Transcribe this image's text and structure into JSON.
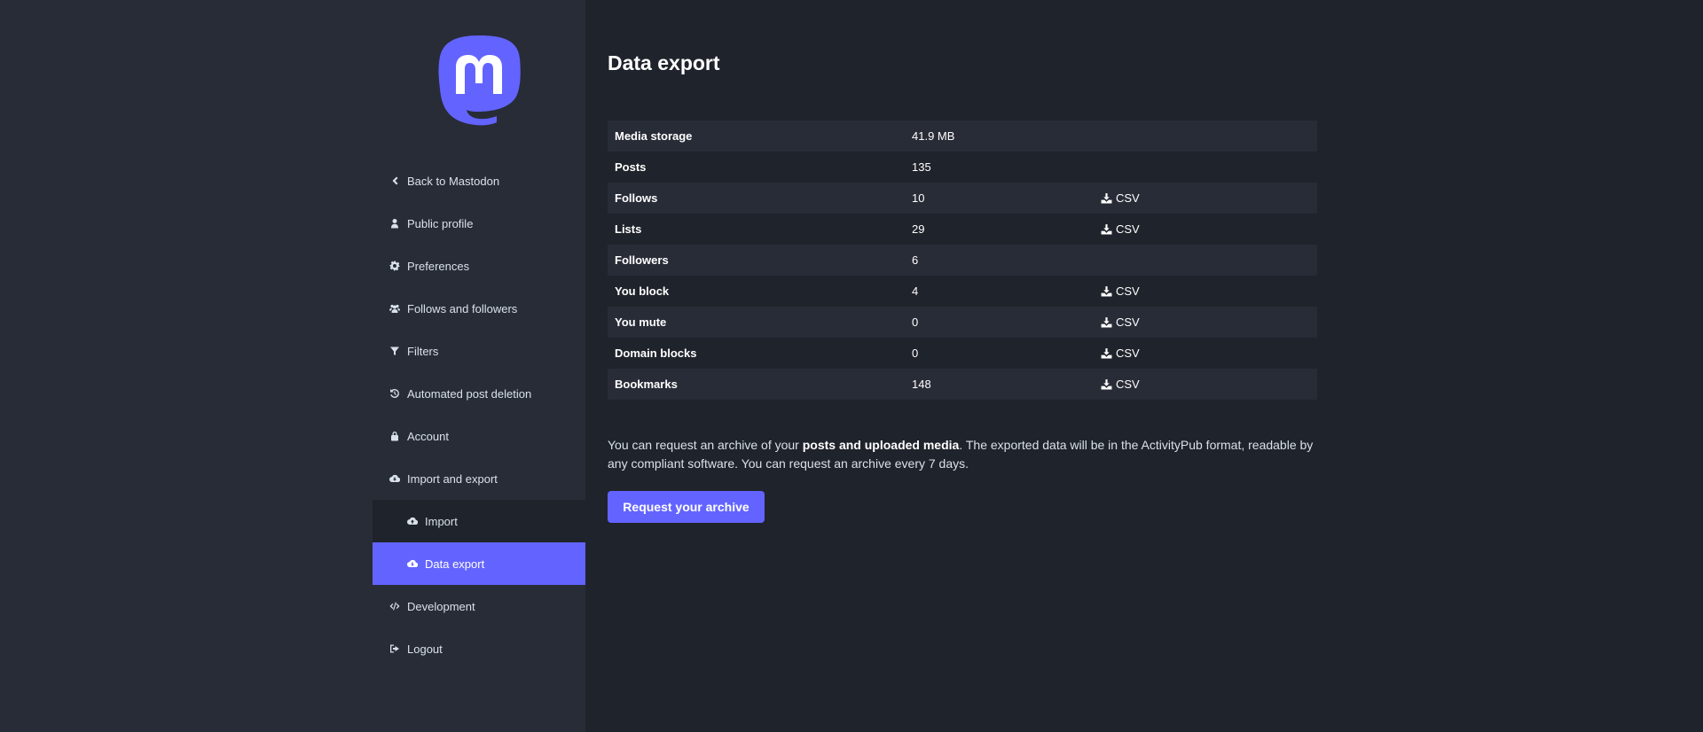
{
  "sidebar": {
    "items": [
      {
        "label": "Back to Mastodon",
        "icon": "chevron-left-icon"
      },
      {
        "label": "Public profile",
        "icon": "user-icon"
      },
      {
        "label": "Preferences",
        "icon": "gear-icon"
      },
      {
        "label": "Follows and followers",
        "icon": "users-icon"
      },
      {
        "label": "Filters",
        "icon": "filter-icon"
      },
      {
        "label": "Automated post deletion",
        "icon": "history-icon"
      },
      {
        "label": "Account",
        "icon": "lock-icon"
      },
      {
        "label": "Import and export",
        "icon": "cloud-download-icon"
      },
      {
        "label": "Import",
        "icon": "cloud-upload-icon"
      },
      {
        "label": "Data export",
        "icon": "cloud-download-icon",
        "active": true
      },
      {
        "label": "Development",
        "icon": "code-icon"
      },
      {
        "label": "Logout",
        "icon": "sign-out-icon"
      }
    ]
  },
  "main": {
    "title": "Data export",
    "rows": [
      {
        "label": "Media storage",
        "value": "41.9 MB",
        "csv": ""
      },
      {
        "label": "Posts",
        "value": "135",
        "csv": ""
      },
      {
        "label": "Follows",
        "value": "10",
        "csv": "CSV"
      },
      {
        "label": "Lists",
        "value": "29",
        "csv": "CSV"
      },
      {
        "label": "Followers",
        "value": "6",
        "csv": ""
      },
      {
        "label": "You block",
        "value": "4",
        "csv": "CSV"
      },
      {
        "label": "You mute",
        "value": "0",
        "csv": "CSV"
      },
      {
        "label": "Domain blocks",
        "value": "0",
        "csv": "CSV"
      },
      {
        "label": "Bookmarks",
        "value": "148",
        "csv": "CSV"
      }
    ],
    "hint": {
      "before": "You can request an archive of your ",
      "strong": "posts and uploaded media",
      "after": ". The exported data will be in the ActivityPub format, readable by any compliant software. You can request an archive every 7 days."
    },
    "button_label": "Request your archive"
  },
  "colors": {
    "accent": "#6364ff",
    "sidebar_bg": "#282c37",
    "page_bg": "#1f232b"
  }
}
